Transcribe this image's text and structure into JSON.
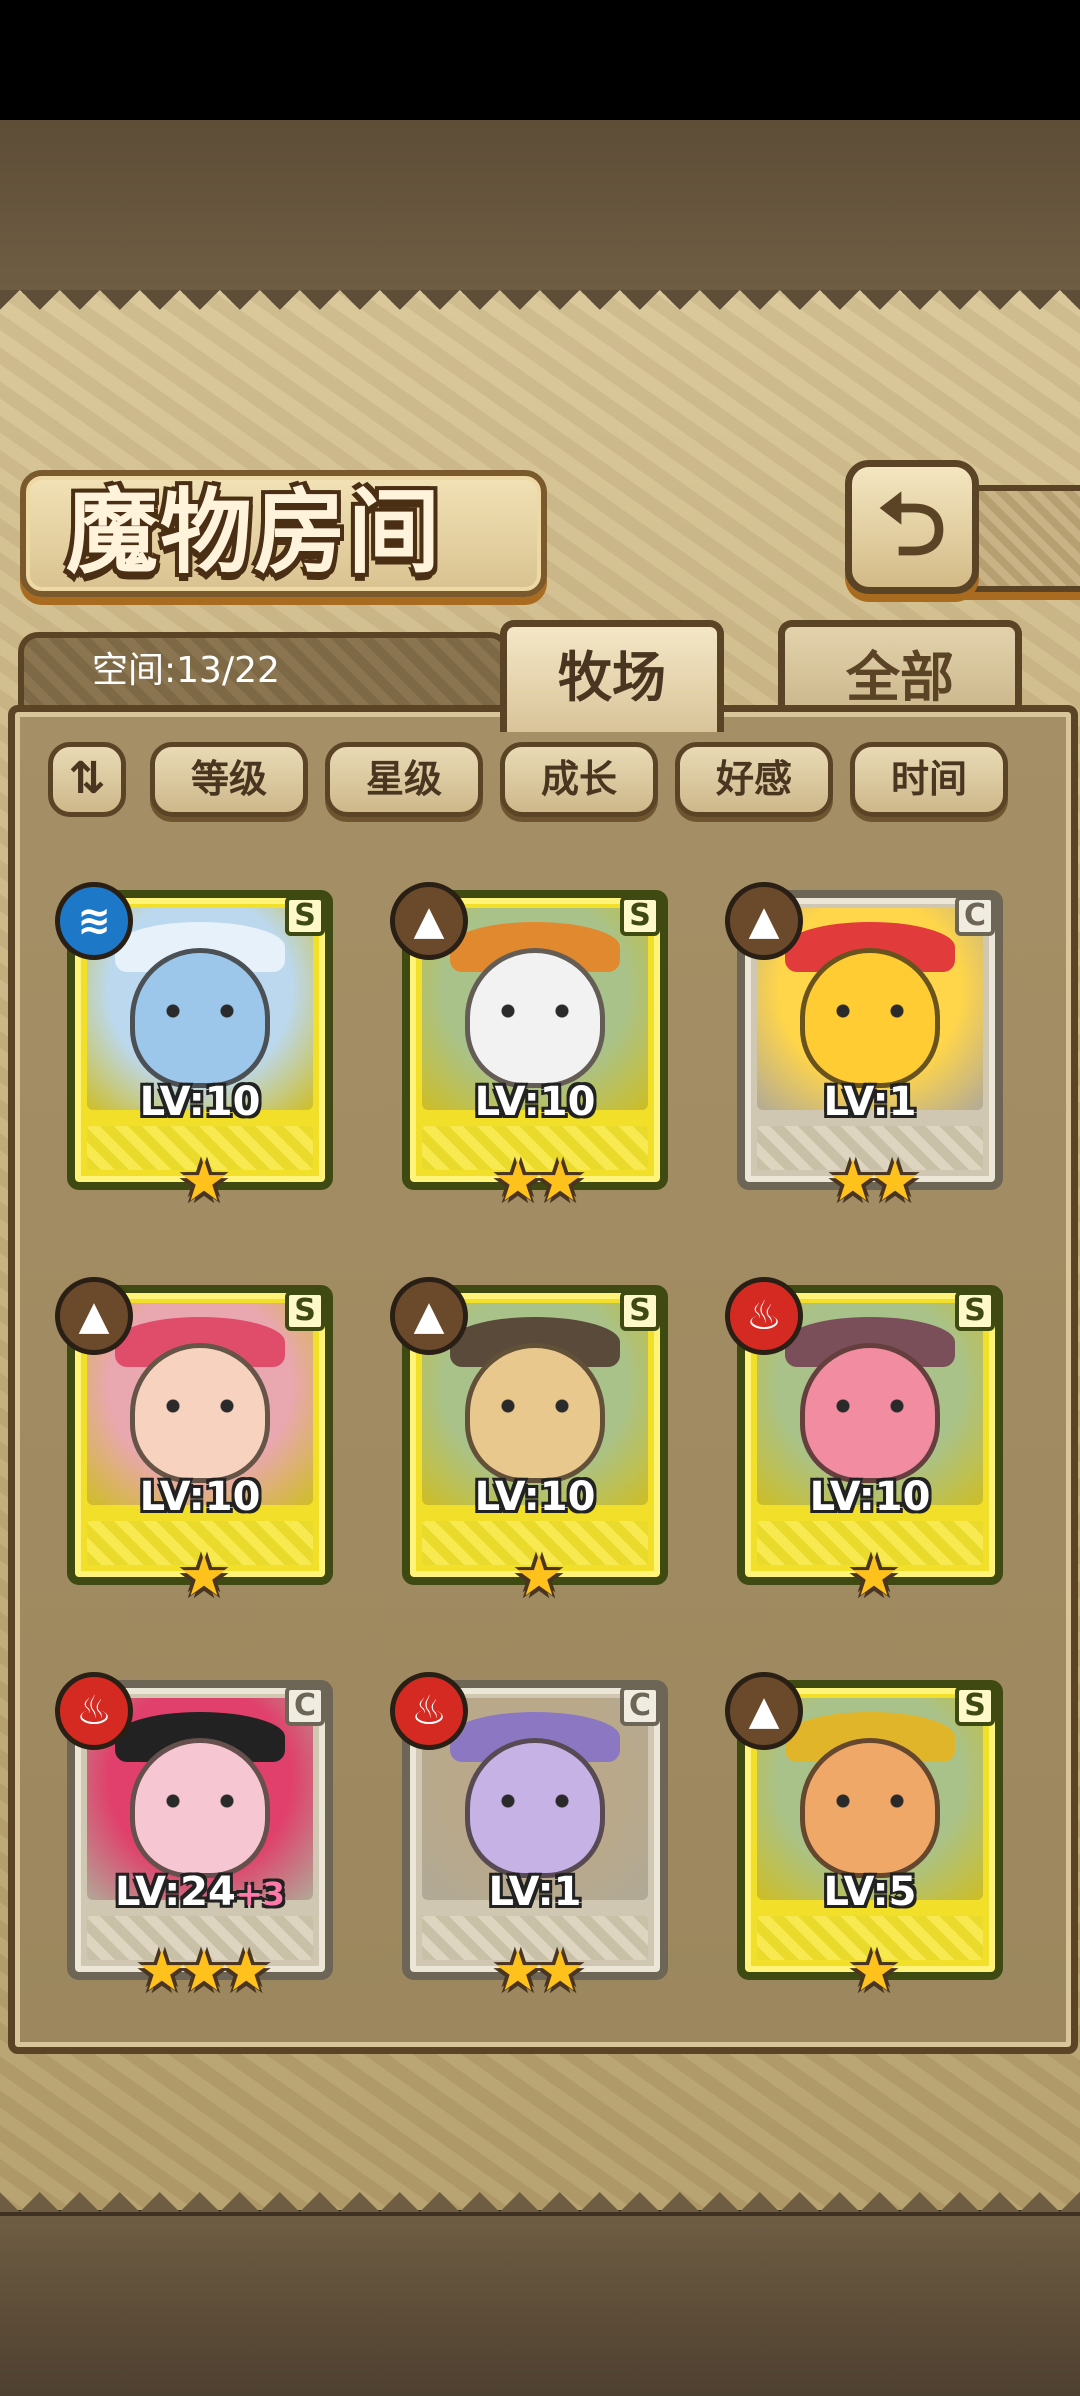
{
  "header": {
    "title": "魔物房间",
    "back_icon": "⮌"
  },
  "info": {
    "space_label": "空间:13/22"
  },
  "tabs": [
    {
      "label": "牧场",
      "active": true
    },
    {
      "label": "全部",
      "active": false
    }
  ],
  "sort": {
    "toggle_icon": "⇅",
    "buttons": [
      "等级",
      "星级",
      "成长",
      "好感",
      "时间"
    ]
  },
  "monsters": [
    {
      "level": "LV:10",
      "bonus": "",
      "rank": "S",
      "stars": "★",
      "element": "water",
      "element_symbol": "≋",
      "frame": "gold",
      "art_color": "#bcd8ee",
      "body_color": "#9cc7ea",
      "hat_color": "#e6f1fa"
    },
    {
      "level": "LV:10",
      "bonus": "",
      "rank": "S",
      "stars": "★★",
      "element": "earth",
      "element_symbol": "▲",
      "frame": "gold",
      "art_color": "#a9c28a",
      "body_color": "#f2f2f2",
      "hat_color": "#e0892e"
    },
    {
      "level": "LV:1",
      "bonus": "",
      "rank": "C",
      "stars": "★★",
      "element": "earth",
      "element_symbol": "▲",
      "frame": "silver",
      "art_color": "#ffd54a",
      "body_color": "#ffcc33",
      "hat_color": "#e23b3b"
    },
    {
      "level": "LV:10",
      "bonus": "",
      "rank": "S",
      "stars": "★",
      "element": "earth",
      "element_symbol": "▲",
      "frame": "gold",
      "art_color": "#e9a7b0",
      "body_color": "#f7d2bf",
      "hat_color": "#e04d6b"
    },
    {
      "level": "LV:10",
      "bonus": "",
      "rank": "S",
      "stars": "★",
      "element": "earth",
      "element_symbol": "▲",
      "frame": "gold",
      "art_color": "#a9c28a",
      "body_color": "#e9c88e",
      "hat_color": "#5a4a3a"
    },
    {
      "level": "LV:10",
      "bonus": "",
      "rank": "S",
      "stars": "★",
      "element": "fire",
      "element_symbol": "♨",
      "frame": "gold",
      "art_color": "#a9c28a",
      "body_color": "#f28ca0",
      "hat_color": "#7a4f5a"
    },
    {
      "level": "LV:24",
      "bonus": "+3",
      "rank": "C",
      "stars": "★★★",
      "element": "fire",
      "element_symbol": "♨",
      "frame": "silver",
      "art_color": "#e0406b",
      "body_color": "#f6c6d2",
      "hat_color": "#222222"
    },
    {
      "level": "LV:1",
      "bonus": "",
      "rank": "C",
      "stars": "★★",
      "element": "fire",
      "element_symbol": "♨",
      "frame": "silver",
      "art_color": "#b9a98a",
      "body_color": "#c7b2e6",
      "hat_color": "#8c78c2"
    },
    {
      "level": "LV:5",
      "bonus": "",
      "rank": "S",
      "stars": "★",
      "element": "earth",
      "element_symbol": "▲",
      "frame": "gold",
      "art_color": "#a9c28a",
      "body_color": "#f0a868",
      "hat_color": "#e0b52a"
    }
  ],
  "colors": {
    "water": "#1e78c8",
    "earth": "#6b4a2c",
    "fire": "#d42a22"
  }
}
